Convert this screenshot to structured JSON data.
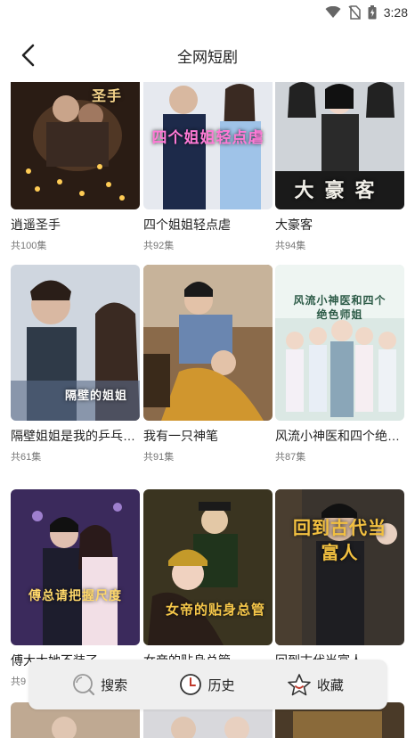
{
  "status": {
    "time": "3:28"
  },
  "header": {
    "title": "全网短剧"
  },
  "grid": [
    {
      "title": "逍遥圣手",
      "episodes": "共100集",
      "cap": "圣手"
    },
    {
      "title": "四个姐姐轻点虐",
      "episodes": "共92集",
      "cap": "四个姐姐轻点虐"
    },
    {
      "title": "大豪客",
      "episodes": "共94集",
      "cap": "大豪客"
    },
    {
      "title": "隔壁姐姐是我的乒乓…",
      "episodes": "共61集",
      "cap": "隔壁的姐姐"
    },
    {
      "title": "我有一只神笔",
      "episodes": "共91集",
      "cap": ""
    },
    {
      "title": "风流小神医和四个绝…",
      "episodes": "共87集",
      "cap": "风流小神医和四个绝色师姐"
    },
    {
      "title": "傅大大她不装了",
      "episodes": "共9",
      "cap": "傅总请把握尺度"
    },
    {
      "title": "女帝的贴身总管",
      "episodes": "",
      "cap": "女帝的贴身总管"
    },
    {
      "title": "回到古代当富人",
      "episodes": "",
      "cap": "回到古代当富人"
    }
  ],
  "bottom_nav": [
    {
      "label": "搜索",
      "icon": "search-icon"
    },
    {
      "label": "历史",
      "icon": "clock-icon"
    },
    {
      "label": "收藏",
      "icon": "star-icon"
    }
  ],
  "colors": {
    "bottom_bar_bg": "#efefef",
    "icon_accent": "#c0392b"
  }
}
